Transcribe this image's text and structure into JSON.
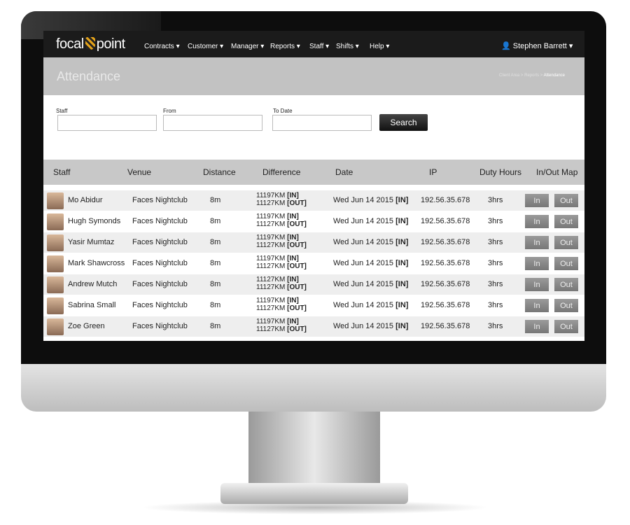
{
  "nav": {
    "logo": "focal point",
    "logo_left": "focal",
    "logo_right": "point",
    "menu": [
      "Contracts ▾",
      "Customer ▾",
      "Manager ▾",
      "Reports ▾",
      "Staff ▾",
      "Shifts ▾",
      "Help ▾"
    ],
    "user": "Stephen Barrett ▾"
  },
  "page": {
    "title": "Attendance",
    "breadcrumb": [
      "Client Area",
      "Reports",
      "Attendance"
    ]
  },
  "form": {
    "staff_label": "Staff",
    "from_label": "From",
    "to_label": "To Date",
    "staff_value": "",
    "from_value": "",
    "to_value": "",
    "search_label": "Search"
  },
  "table": {
    "headers": [
      "Staff",
      "Venue",
      "Distance",
      "Difference",
      "Date",
      "IP",
      "Duty Hours",
      "In/Out Map"
    ],
    "rows": [
      {
        "name": "Mo Abidur",
        "venue": "Faces Nightclub",
        "distance": "8m",
        "diff_in": "11197KM",
        "diff_out": "11127KM",
        "date": "Wed Jun 14 2015",
        "ip": "192.56.35.678",
        "hours": "3hrs"
      },
      {
        "name": "Hugh Symonds",
        "venue": "Faces Nightclub",
        "distance": "8m",
        "diff_in": "11197KM",
        "diff_out": "11127KM",
        "date": "Wed Jun 14 2015",
        "ip": "192.56.35.678",
        "hours": "3hrs"
      },
      {
        "name": "Yasir Mumtaz",
        "venue": "Faces Nightclub",
        "distance": "8m",
        "diff_in": "11197KM",
        "diff_out": "11127KM",
        "date": "Wed Jun 14 2015",
        "ip": "192.56.35.678",
        "hours": "3hrs"
      },
      {
        "name": "Mark Shawcross",
        "venue": "Faces Nightclub",
        "distance": "8m",
        "diff_in": "11197KM",
        "diff_out": "11127KM",
        "date": "Wed Jun 14 2015",
        "ip": "192.56.35.678",
        "hours": "3hrs"
      },
      {
        "name": "Andrew Mutch",
        "venue": "Faces Nightclub",
        "distance": "8m",
        "diff_in": "11127KM",
        "diff_out": "11127KM",
        "date": "Wed Jun 14 2015",
        "ip": "192.56.35.678",
        "hours": "3hrs"
      },
      {
        "name": "Sabrina Small",
        "venue": "Faces Nightclub",
        "distance": "8m",
        "diff_in": "11197KM",
        "diff_out": "11127KM",
        "date": "Wed Jun 14 2015",
        "ip": "192.56.35.678",
        "hours": "3hrs"
      },
      {
        "name": "Zoe Green",
        "venue": "Faces Nightclub",
        "distance": "8m",
        "diff_in": "11197KM",
        "diff_out": "11127KM",
        "date": "Wed Jun 14 2015",
        "ip": "192.56.35.678",
        "hours": "3hrs"
      }
    ],
    "in_tag": "[IN]",
    "out_tag": "[OUT]",
    "in_button": "In",
    "out_button": "Out"
  },
  "colors": {
    "nav": "#1b1b1b",
    "titlebar": "#c2c2c2",
    "header": "#c8c8c8",
    "accent": "#e3a21a"
  }
}
